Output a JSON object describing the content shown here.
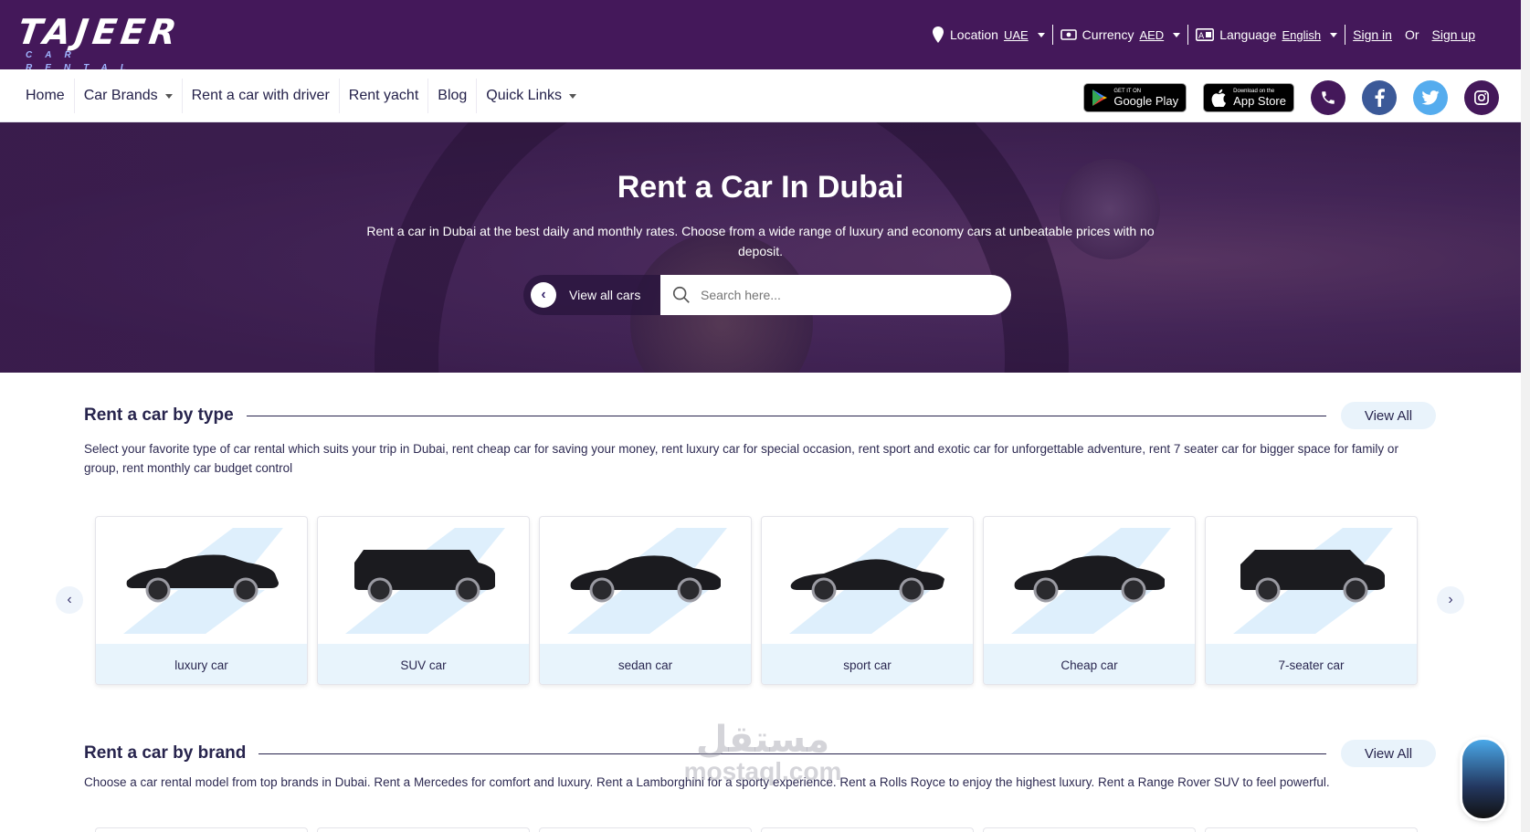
{
  "brand": {
    "logo_main": "TAJEER",
    "logo_sub": "CAR RENTAL"
  },
  "topbar": {
    "location_label": "Location",
    "location_value": "UAE",
    "currency_label": "Currency",
    "currency_value": "AED",
    "language_label": "Language",
    "language_value": "English",
    "sign_in": "Sign in",
    "or": "Or",
    "sign_up": "Sign up"
  },
  "nav": {
    "items": [
      {
        "label": "Home"
      },
      {
        "label": "Car Brands"
      },
      {
        "label": "Rent a car with driver"
      },
      {
        "label": "Rent yacht"
      },
      {
        "label": "Blog"
      },
      {
        "label": "Quick Links"
      }
    ],
    "google_play_small": "GET IT ON",
    "google_play_big": "Google Play",
    "app_store_small": "Download on the",
    "app_store_big": "App Store"
  },
  "hero": {
    "title": "Rent a Car In Dubai",
    "text": "Rent a car in Dubai at the best daily and monthly rates. Choose from a wide range of luxury and economy cars at unbeatable prices with no deposit.",
    "view_all_cars": "View all cars",
    "search_placeholder": "Search here..."
  },
  "by_type": {
    "title": "Rent a car by type",
    "view_all": "View All",
    "description": "Select your favorite type of car rental which suits your trip in Dubai, rent cheap car for saving your money, rent luxury car for special occasion, rent sport and exotic car for unforgettable adventure, rent 7 seater car for bigger space for family or group, rent monthly car budget control",
    "cards": [
      {
        "label": "luxury car",
        "shape": "sedan-long"
      },
      {
        "label": "SUV car",
        "shape": "suv-box"
      },
      {
        "label": "sedan car",
        "shape": "sedan"
      },
      {
        "label": "sport car",
        "shape": "sport"
      },
      {
        "label": "Cheap car",
        "shape": "sedan"
      },
      {
        "label": "7-seater car",
        "shape": "suv"
      }
    ]
  },
  "by_brand": {
    "title": "Rent a car by brand",
    "view_all": "View All",
    "description": "Choose a car rental model from top brands in Dubai. Rent a Mercedes for comfort and luxury. Rent a Lamborghini for a sporty experience. Rent a Rolls Royce to enjoy the highest luxury. Rent a Range Rover SUV to feel powerful."
  },
  "watermark": {
    "arabic": "مستقل",
    "latin": "mostaql.com"
  },
  "colors": {
    "primary": "#44185a",
    "accent_light": "#e8f4fc",
    "text_dark": "#27244d"
  },
  "icons": [
    "location-pin-icon",
    "currency-icon",
    "language-icon",
    "chevron-left-icon",
    "chevron-right-icon",
    "search-icon",
    "phone-icon",
    "facebook-icon",
    "twitter-icon",
    "instagram-icon",
    "google-play-icon",
    "apple-icon"
  ]
}
